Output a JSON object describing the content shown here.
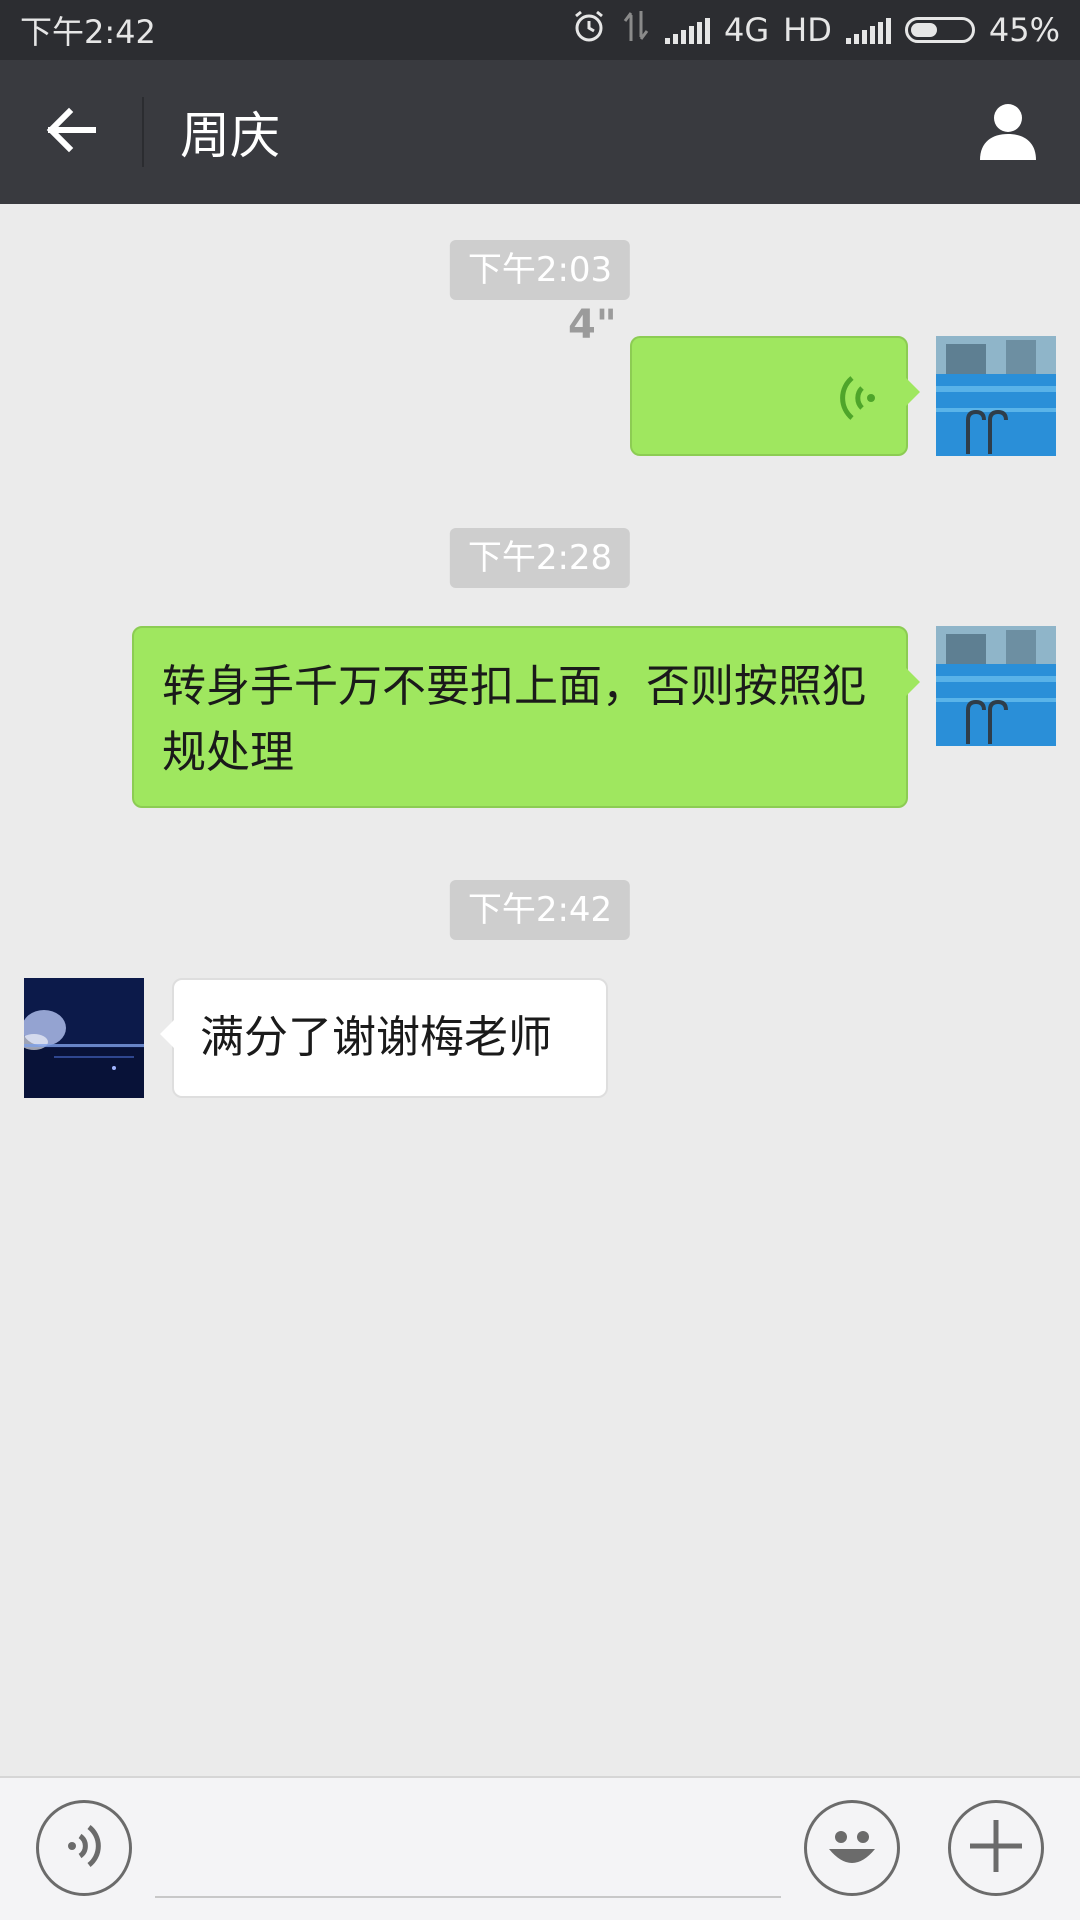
{
  "status_bar": {
    "time": "下午2:42",
    "network": "4G",
    "hd": "HD",
    "battery_level": 0.45,
    "battery": "45%",
    "icons": [
      "alarm-icon",
      "data-transfer-icon",
      "signal-icon",
      "battery-icon"
    ]
  },
  "nav": {
    "title": "周庆",
    "back_icon": "back-arrow-icon",
    "profile_icon": "person-icon"
  },
  "messages": [
    {
      "type": "timestamp",
      "text": "下午2:03"
    },
    {
      "type": "voice",
      "side": "right",
      "duration": "4\""
    },
    {
      "type": "timestamp",
      "text": "下午2:28"
    },
    {
      "type": "text",
      "side": "right",
      "text": "转身手千万不要扣上面，否则按照犯规处理"
    },
    {
      "type": "timestamp",
      "text": "下午2:42"
    },
    {
      "type": "text",
      "side": "left",
      "text": "满分了谢谢梅老师"
    }
  ],
  "input_bar": {
    "voice_icon": "voice-input-icon",
    "emoji_icon": "emoji-icon",
    "plus_icon": "plus-icon",
    "value": ""
  },
  "colors": {
    "nav_bg": "#393a3f",
    "status_bg": "#2c2d31",
    "chat_bg": "#ebebeb",
    "sent_bubble": "#9fe75f",
    "received_bubble": "#ffffff"
  }
}
